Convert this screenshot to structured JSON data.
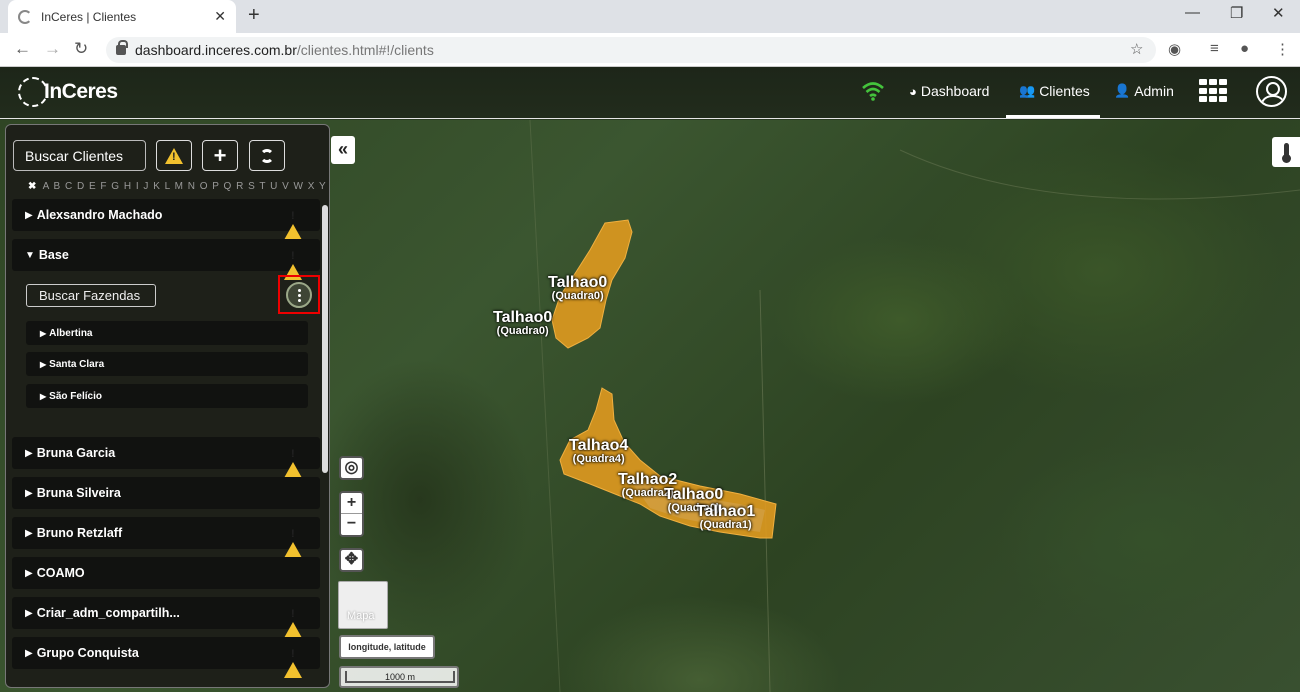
{
  "browser": {
    "tab_title": "InCeres | Clientes",
    "url_host": "dashboard.inceres.com.br",
    "url_path": "/clientes.html#!/clients"
  },
  "header": {
    "logo_text": "InCeres",
    "menu": [
      {
        "label": "Dashboard",
        "icon": "dashboard-icon"
      },
      {
        "label": "Clientes",
        "icon": "users-icon"
      },
      {
        "label": "Admin",
        "icon": "user-plus-icon"
      }
    ],
    "colors": {
      "wifi": "#44c33c",
      "accent": "#ffffff"
    }
  },
  "sidebar": {
    "search_placeholder": "Buscar Clientes",
    "alphabet": "A B C D E F G H I J K L M N O P Q R S T U V W X Y Z",
    "clients": [
      {
        "label": "Alexsandro Machado",
        "warning": true
      },
      {
        "label": "Base",
        "warning": true,
        "expanded": true
      },
      {
        "label": "Bruna Garcia",
        "warning": true
      },
      {
        "label": "Bruna Silveira",
        "warning": false
      },
      {
        "label": "Bruno Retzlaff",
        "warning": true
      },
      {
        "label": "COAMO",
        "warning": false
      },
      {
        "label": "Criar_adm_compartilh...",
        "warning": true
      },
      {
        "label": "Grupo Conquista",
        "warning": true
      }
    ],
    "farms_placeholder": "Buscar Fazendas",
    "farms": [
      "Albertina",
      "Santa Clara",
      "São Felício"
    ]
  },
  "map": {
    "fields": [
      {
        "name": "Talhao0",
        "sub": "(Quadra0)"
      },
      {
        "name": "Talhao0",
        "sub": "(Quadra0)"
      },
      {
        "name": "Talhao4",
        "sub": "(Quadra4)"
      },
      {
        "name": "Talhao2",
        "sub": "(Quadra2)"
      },
      {
        "name": "Talhao0",
        "sub": "(Quadra0)"
      },
      {
        "name": "Talhao1",
        "sub": "(Quadra1)"
      }
    ],
    "basemap_label": "Mapa",
    "coords_label": "longitude, latitude",
    "scale_label": "1000 m",
    "field_color": "#e09a1f"
  }
}
